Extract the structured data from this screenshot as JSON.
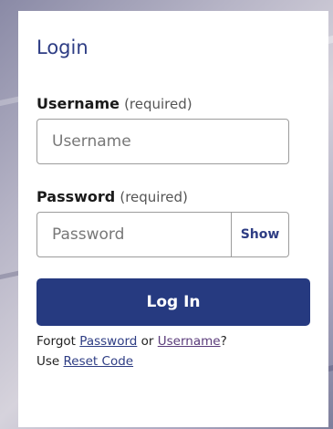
{
  "login": {
    "title": "Login",
    "username": {
      "label": "Username",
      "required_note": "(required)",
      "placeholder": "Username",
      "value": ""
    },
    "password": {
      "label": "Password",
      "required_note": "(required)",
      "placeholder": "Password",
      "value": "",
      "show_label": "Show"
    },
    "submit_label": "Log In",
    "help": {
      "forgot_prefix": "Forgot ",
      "password_link": "Password",
      "or_text": " or ",
      "username_link": "Username",
      "forgot_suffix": "?",
      "use_prefix": "Use ",
      "reset_code_link": "Reset Code"
    }
  },
  "colors": {
    "accent": "#263a80",
    "title": "#2e3d84",
    "card_bg": "#ffffff"
  }
}
